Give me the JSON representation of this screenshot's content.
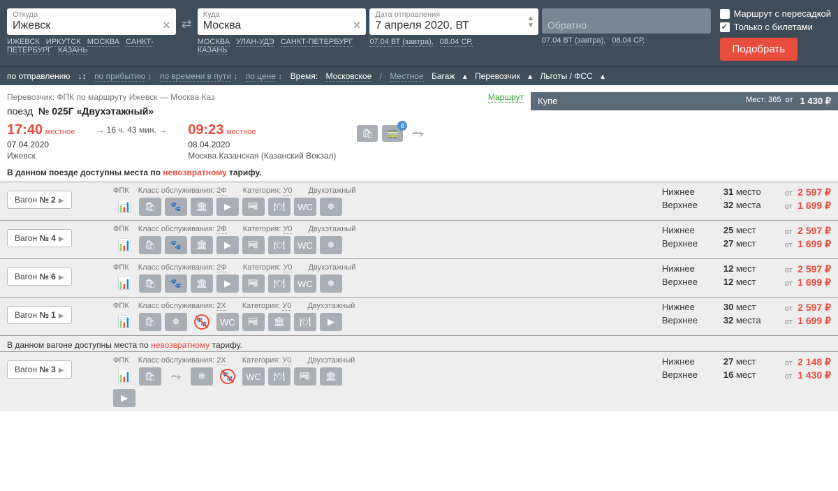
{
  "search": {
    "from_label": "Откуда",
    "from_value": "Ижевск",
    "from_quick": [
      "ИЖЕВСК",
      "ИРКУТСК",
      "МОСКВА",
      "САНКТ-ПЕТЕРБУРГ",
      "КАЗАНЬ"
    ],
    "to_label": "Куда",
    "to_value": "Москва",
    "to_quick": [
      "МОСКВА",
      "УЛАН-УДЭ",
      "САНКТ-ПЕТЕРБУРГ",
      "КАЗАНЬ"
    ],
    "date_label": "Дата отправления",
    "date_value": "7 апреля 2020, ВТ",
    "date_quick": [
      "07.04 ВТ (завтра)",
      "08.04 СР"
    ],
    "return_value": "Обратно",
    "return_quick": [
      "07.04 ВТ (завтра)",
      "08.04 СР"
    ],
    "transfer_label": "Маршрут с пересадкой",
    "tickets_label": "Только с билетами",
    "submit": "Подобрать"
  },
  "sortbar": {
    "dep": "по отправлению",
    "arr": "по прибытию",
    "dur": "по времени в пути",
    "price": "по цене",
    "time_label": "Время:",
    "moscow": "Московское",
    "local": "Местное",
    "baggage": "Багаж",
    "carrier": "Перевозчик",
    "benefits": "Льготы / ФСС"
  },
  "train": {
    "carrier_line": "Перевозчик: ФПК   по маршруту Ижевск — Москва Каз",
    "route_link": "Маршрут",
    "name_prefix": "поезд",
    "name_num": "№ 025Г «Двухэтажный»",
    "dep_time": "17:40",
    "dep_local": "местное",
    "dep_date": "07.04.2020",
    "dep_station": "Ижевск",
    "duration": "16 ч. 43 мин.",
    "arr_time": "09:23",
    "arr_local": "местное",
    "arr_date": "08.04.2020",
    "arr_station": "Москва Казанская (Казанский Вокзал)",
    "nonrefund": "В данном поезде доступны места по ",
    "nonrefund_red": "невозвратному",
    "nonrefund_end": " тарифу."
  },
  "compartment": {
    "type": "Купе",
    "seats_label": "Мест: 365",
    "from": "от",
    "price": "1 430 ₽"
  },
  "wagons": [
    {
      "num": "2",
      "meta": {
        "carrier": "ФПК",
        "class_label": "Класс обслуживания:",
        "class": "2Ф",
        "cat_label": "Категория:",
        "cat": "У0",
        "deck": "Двухэтажный"
      },
      "icons": [
        "graph",
        "bag",
        "pet",
        "column",
        "media",
        "news",
        "food",
        "wc",
        "snow"
      ],
      "seats": [
        {
          "label": "Нижнее",
          "count": "31 место",
          "price": "2 597 ₽"
        },
        {
          "label": "Верхнее",
          "count": "32 места",
          "price": "1 699 ₽"
        }
      ]
    },
    {
      "num": "4",
      "meta": {
        "carrier": "ФПК",
        "class_label": "Класс обслуживания:",
        "class": "2Ф",
        "cat_label": "Категория:",
        "cat": "У0",
        "deck": "Двухэтажный"
      },
      "icons": [
        "graph",
        "bag",
        "pet",
        "column",
        "media",
        "news",
        "food",
        "wc",
        "snow"
      ],
      "seats": [
        {
          "label": "Нижнее",
          "count": "25 мест",
          "price": "2 597 ₽"
        },
        {
          "label": "Верхнее",
          "count": "27 мест",
          "price": "1 699 ₽"
        }
      ]
    },
    {
      "num": "6",
      "meta": {
        "carrier": "ФПК",
        "class_label": "Класс обслуживания:",
        "class": "2Ф",
        "cat_label": "Категория:",
        "cat": "У0",
        "deck": "Двухэтажный"
      },
      "icons": [
        "graph",
        "bag",
        "pet",
        "column",
        "media",
        "news",
        "food",
        "wc",
        "snow"
      ],
      "seats": [
        {
          "label": "Нижнее",
          "count": "12 мест",
          "price": "2 597 ₽"
        },
        {
          "label": "Верхнее",
          "count": "12 мест",
          "price": "1 699 ₽"
        }
      ]
    },
    {
      "num": "1",
      "meta": {
        "carrier": "ФПК",
        "class_label": "Класс обслуживания:",
        "class": "2Х",
        "cat_label": "Категория:",
        "cat": "У0",
        "deck": "Двухэтажный"
      },
      "icons": [
        "graph",
        "bag",
        "snow",
        "nopet",
        "wc",
        "news",
        "column",
        "food",
        "media"
      ],
      "seats": [
        {
          "label": "Нижнее",
          "count": "30 мест",
          "price": "2 597 ₽"
        },
        {
          "label": "Верхнее",
          "count": "32 места",
          "price": "1 699 ₽"
        }
      ]
    },
    {
      "num": "3",
      "note": "В данном вагоне доступны места по невозвратному тарифу.",
      "meta": {
        "carrier": "ФПК",
        "class_label": "Класс обслуживания:",
        "class": "2Х",
        "cat_label": "Категория:",
        "cat": "У0",
        "deck": "Двухэтажный"
      },
      "icons": [
        "graph",
        "bag",
        "strike",
        "snow",
        "nopet",
        "wc",
        "food",
        "news",
        "column"
      ],
      "icons2": [
        "media"
      ],
      "seats": [
        {
          "label": "Нижнее",
          "count": "27 мест",
          "price": "2 148 ₽"
        },
        {
          "label": "Верхнее",
          "count": "16 мест",
          "price": "1 430 ₽"
        }
      ]
    }
  ],
  "txt": {
    "wagon": "Вагон",
    "from": "от"
  }
}
